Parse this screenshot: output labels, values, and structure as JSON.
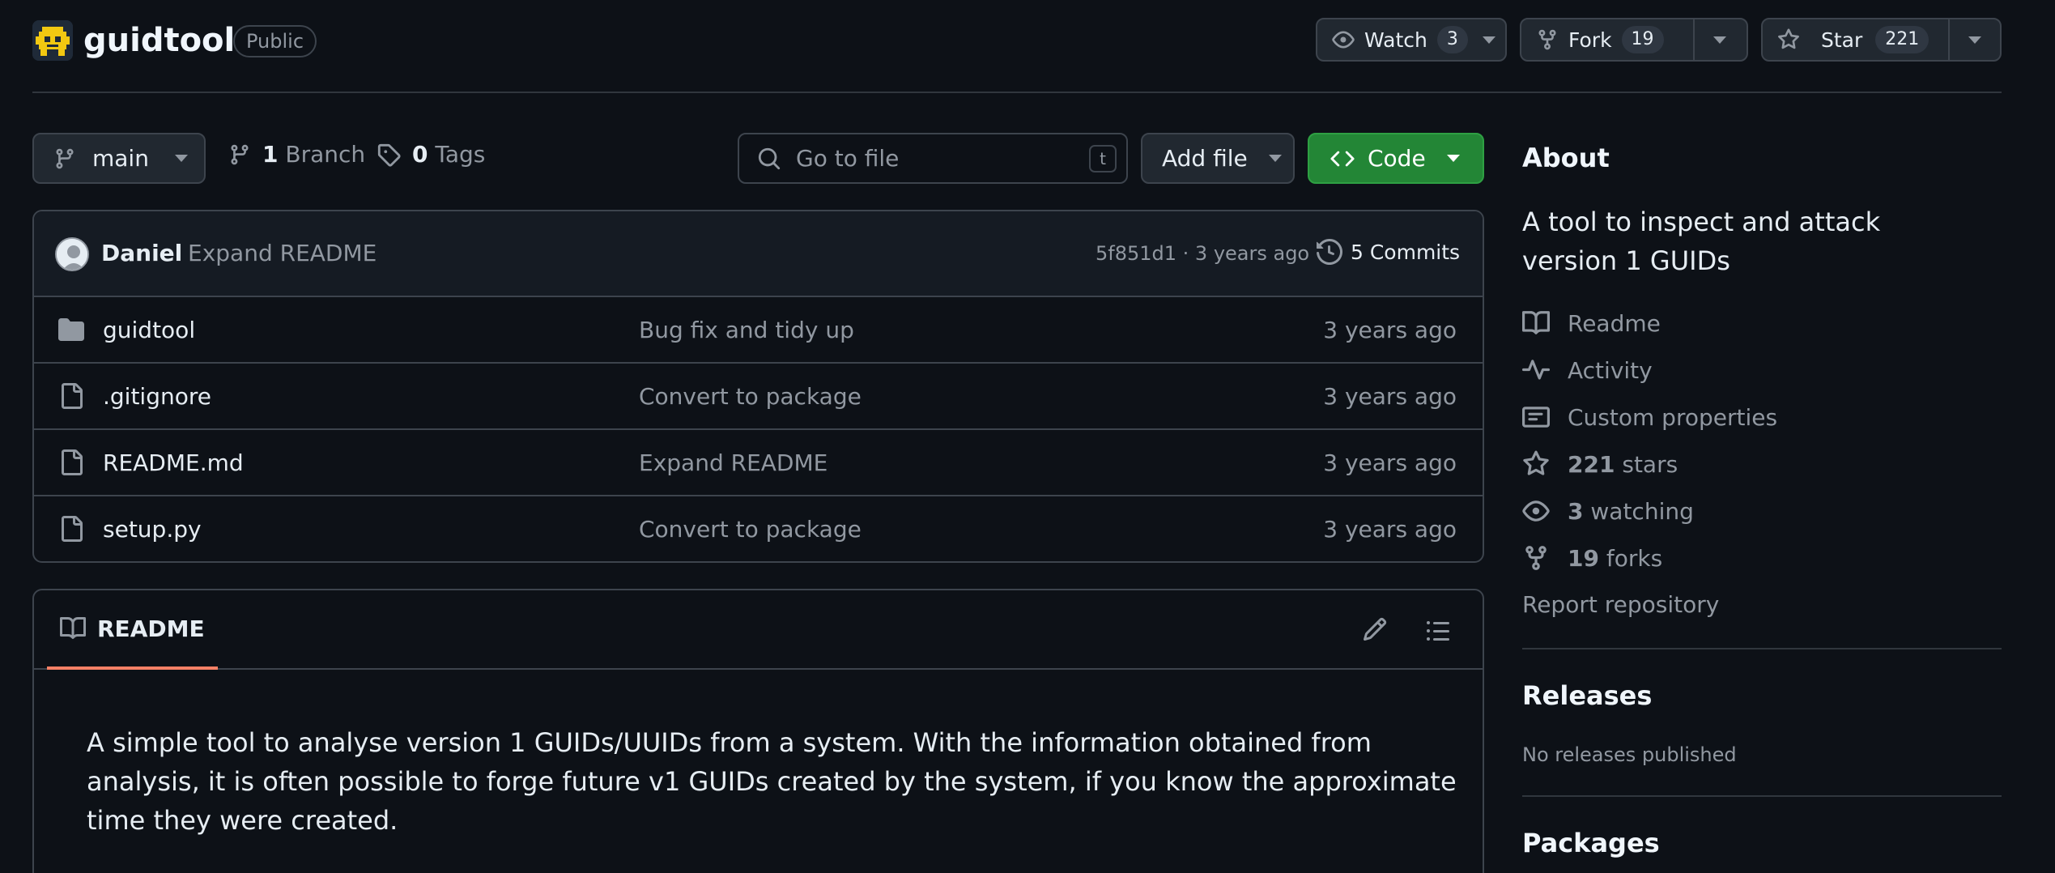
{
  "header": {
    "repo_name": "guidtool",
    "visibility": "Public",
    "watch": {
      "label": "Watch",
      "count": "3"
    },
    "fork": {
      "label": "Fork",
      "count": "19"
    },
    "star": {
      "label": "Star",
      "count": "221"
    }
  },
  "toolbar": {
    "branch": "main",
    "branches_count": "1",
    "branches_label": "Branch",
    "tags_count": "0",
    "tags_label": "Tags",
    "search_placeholder": "Go to file",
    "search_shortcut": "t",
    "add_file_label": "Add file",
    "code_label": "Code"
  },
  "latest_commit": {
    "author": "Daniel",
    "message": "Expand README",
    "meta": "5f851d1 · 3 years ago",
    "commits_label": "5 Commits"
  },
  "files": [
    {
      "name": "guidtool",
      "type": "folder",
      "message": "Bug fix and tidy up",
      "time": "3 years ago"
    },
    {
      "name": ".gitignore",
      "type": "file",
      "message": "Convert to package",
      "time": "3 years ago"
    },
    {
      "name": "README.md",
      "type": "file",
      "message": "Expand README",
      "time": "3 years ago"
    },
    {
      "name": "setup.py",
      "type": "file",
      "message": "Convert to package",
      "time": "3 years ago"
    }
  ],
  "readme": {
    "tab_label": "README",
    "body": "A simple tool to analyse version 1 GUIDs/UUIDs from a system. With the information obtained from analysis, it is often possible to forge future v1 GUIDs created by the system, if you know the approximate time they were created."
  },
  "sidebar": {
    "about_title": "About",
    "description": "A tool to inspect and attack version 1 GUIDs",
    "readme_label": "Readme",
    "activity_label": "Activity",
    "custom_properties_label": "Custom properties",
    "stars_count": "221",
    "stars_label": "stars",
    "watching_count": "3",
    "watching_label": "watching",
    "forks_count": "19",
    "forks_label": "forks",
    "report_label": "Report repository",
    "releases_title": "Releases",
    "releases_empty": "No releases published",
    "packages_title": "Packages"
  },
  "colors": {
    "background": "#0d1117",
    "code_button": "#238636",
    "tab_underline": "#f78166",
    "border": "#3d444d"
  }
}
